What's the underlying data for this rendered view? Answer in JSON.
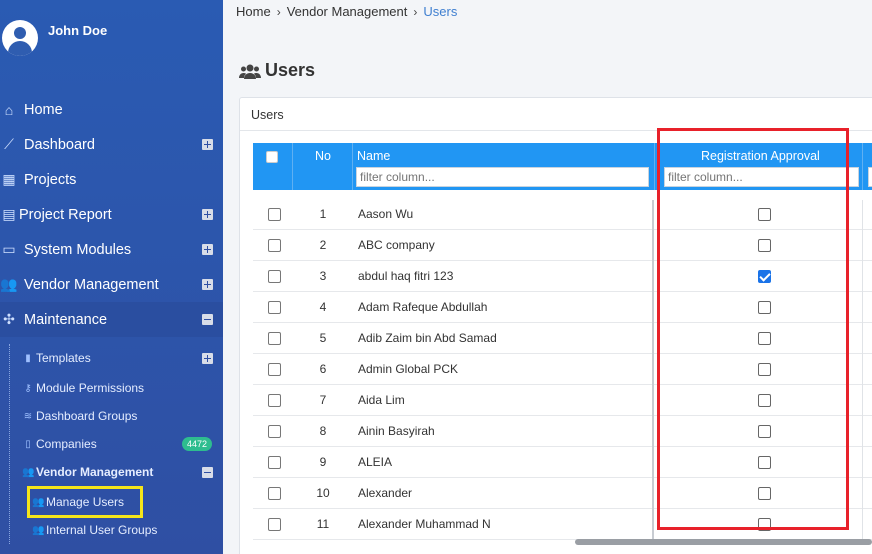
{
  "user": {
    "name": "John Doe"
  },
  "sidebar": {
    "items": [
      {
        "label": "Home",
        "icon": "home-icon",
        "expander": ""
      },
      {
        "label": "Dashboard",
        "icon": "chart-icon",
        "expander": "plus"
      },
      {
        "label": "Projects",
        "icon": "table-icon",
        "expander": ""
      },
      {
        "label": "Project Report",
        "icon": "report-icon",
        "expander": "plus"
      },
      {
        "label": "System Modules",
        "icon": "monitor-icon",
        "expander": "plus"
      },
      {
        "label": "Vendor Management",
        "icon": "users-icon",
        "expander": "plus"
      },
      {
        "label": "Maintenance",
        "icon": "network-icon",
        "expander": "minus"
      }
    ],
    "subitems": [
      {
        "label": "Templates",
        "icon": "file-icon",
        "expander": "plus"
      },
      {
        "label": "Module Permissions",
        "icon": "key-icon"
      },
      {
        "label": "Dashboard Groups",
        "icon": "layers-icon"
      },
      {
        "label": "Companies",
        "icon": "building-icon",
        "badge": "4472"
      },
      {
        "label": "Vendor Management",
        "icon": "users-icon",
        "expander": "minus"
      },
      {
        "label": "Manage Users",
        "icon": "users-icon"
      },
      {
        "label": "Internal User Groups",
        "icon": "users-icon"
      }
    ]
  },
  "breadcrumb": [
    "Home",
    "Vendor Management",
    "Users"
  ],
  "page": {
    "title": "Users"
  },
  "card": {
    "title": "Users"
  },
  "table": {
    "columns": {
      "no": "No",
      "name": "Name",
      "approval": "Registration Approval"
    },
    "filter_placeholder": "filter column...",
    "rows": [
      {
        "no": "1",
        "name": "Aason Wu",
        "approved": false
      },
      {
        "no": "2",
        "name": "ABC company",
        "approved": false
      },
      {
        "no": "3",
        "name": "abdul haq fitri 123",
        "approved": true
      },
      {
        "no": "4",
        "name": "Adam Rafeque Abdullah",
        "approved": false
      },
      {
        "no": "5",
        "name": "Adib Zaim bin Abd Samad",
        "approved": false
      },
      {
        "no": "6",
        "name": "Admin Global PCK",
        "approved": false
      },
      {
        "no": "7",
        "name": "Aida Lim",
        "approved": false
      },
      {
        "no": "8",
        "name": "Ainin Basyirah",
        "approved": false
      },
      {
        "no": "9",
        "name": "ALEIA",
        "approved": false
      },
      {
        "no": "10",
        "name": "Alexander",
        "approved": false
      },
      {
        "no": "11",
        "name": "Alexander Muhammad N",
        "approved": false
      }
    ]
  },
  "colors": {
    "sidebar": "#2f4fa3",
    "header": "#2196f3",
    "highlight_red": "#e8212a",
    "highlight_yellow": "#f5e61a",
    "badge": "#2ebd8f"
  }
}
